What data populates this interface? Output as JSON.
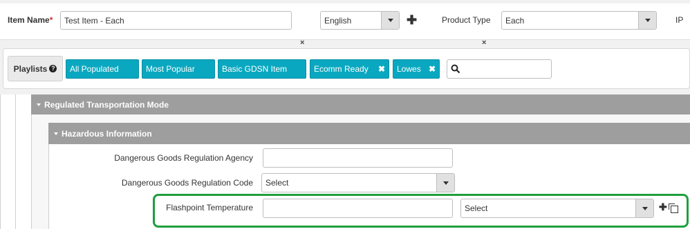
{
  "header": {
    "item_name_label": "Item Name",
    "required_mark": "*",
    "item_name_value": "Test Item - Each",
    "language_select": "English",
    "add_icon": "plus-icon",
    "product_type_label": "Product Type",
    "product_type_value": "Each",
    "ip_label": "IP",
    "x_glyph": "×"
  },
  "playlists": {
    "label": "Playlists",
    "help_icon": "question-circle-icon",
    "help_glyph": "?",
    "tags": [
      {
        "label": "All Populated"
      },
      {
        "label": "Most Popular"
      },
      {
        "label": "Basic GDSN Item"
      },
      {
        "label": "Ecomm Ready",
        "remove": "✖"
      },
      {
        "label": "Lowes",
        "remove": "✖"
      }
    ],
    "search_placeholder": "",
    "search_icon": "search-icon"
  },
  "sections": {
    "regulated_transport": "Regulated Transportation Mode",
    "hazardous_info": "Hazardous Information"
  },
  "fields": {
    "dg_agency_label": "Dangerous Goods Regulation Agency",
    "dg_agency_value": "",
    "dg_code_label": "Dangerous Goods Regulation Code",
    "dg_code_select": "Select",
    "flashpoint_label": "Flashpoint Temperature",
    "flashpoint_value": "",
    "flashpoint_unit_select": "Select"
  },
  "colors": {
    "accent_teal": "#0aa8c0",
    "section_gray": "#9e9e9e",
    "highlight_green": "#1f9e3c",
    "required_red": "#c9302c"
  }
}
